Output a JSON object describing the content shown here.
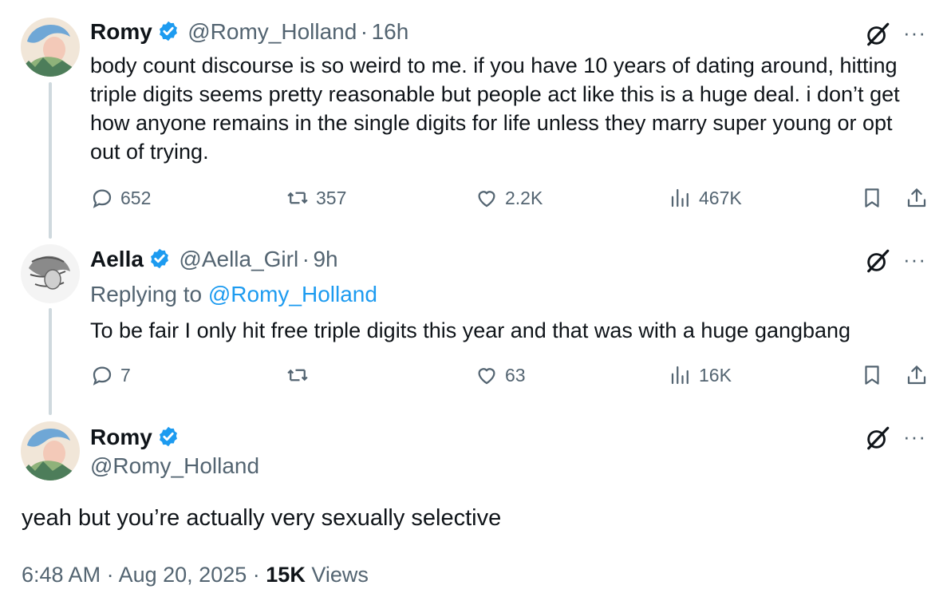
{
  "tweets": [
    {
      "name": "Romy",
      "handle": "@Romy_Holland",
      "time": "16h",
      "text": "body count discourse is so weird to me. if you have 10 years of dating around, hitting triple digits seems pretty reasonable but people act like this is a huge deal. i don’t get how anyone remains in the single digits for life unless they marry super young or opt out of trying.",
      "replies": "652",
      "reposts": "357",
      "likes": "2.2K",
      "views": "467K"
    },
    {
      "name": "Aella",
      "handle": "@Aella_Girl",
      "time": "9h",
      "replying_prefix": "Replying to ",
      "replying_to": "@Romy_Holland",
      "text": "To be fair I only hit free triple digits this year and that was with a huge gangbang",
      "replies": "7",
      "reposts": "",
      "likes": "63",
      "views": "16K"
    }
  ],
  "main": {
    "name": "Romy",
    "handle": "@Romy_Holland",
    "text": "yeah but you’re actually very sexually selective",
    "time": "6:48 AM",
    "date": "Aug 20, 2025",
    "views_count": "15K",
    "views_label": "Views"
  },
  "separator": "·",
  "icons": {
    "verified": "verified-badge-icon",
    "grok": "grok-icon",
    "more": "more-icon",
    "reply": "reply-icon",
    "repost": "repost-icon",
    "like": "like-icon",
    "views": "views-icon",
    "bookmark": "bookmark-icon",
    "share": "share-icon"
  },
  "colors": {
    "text": "#0f1419",
    "secondary": "#536471",
    "accent": "#1d9bf0",
    "thread_line": "#cfd9de"
  }
}
